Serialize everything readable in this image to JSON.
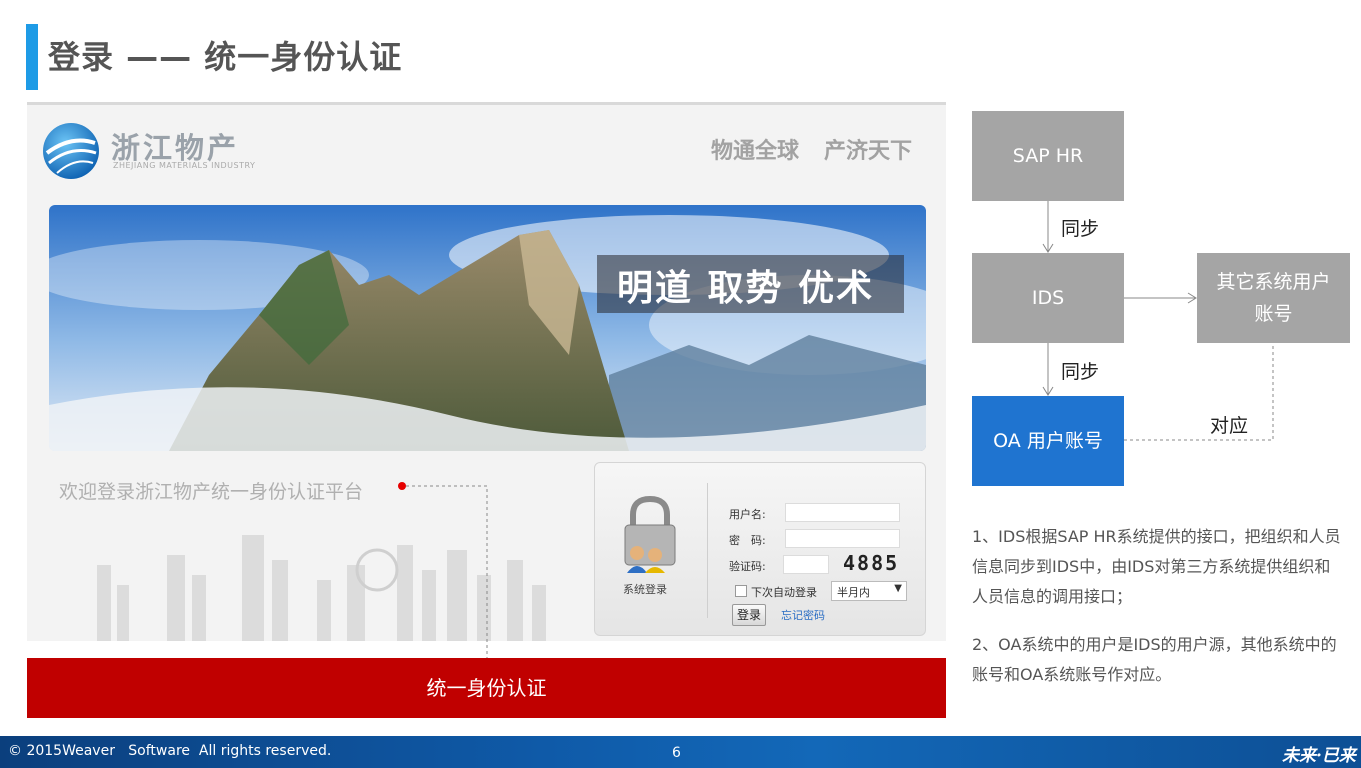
{
  "header": {
    "title": "登录 —— 统一身份认证"
  },
  "screenshot": {
    "brand_name": "浙江物产",
    "brand_sub": "ZHEJIANG MATERIALS INDUSTRY",
    "slogan_1": "物通全球",
    "slogan_2": "产济天下",
    "banner_motto": "明道 取势 优术",
    "welcome_text": "欢迎登录浙江物产统一身份认证平台",
    "login_box": {
      "icon": "padlock-users-icon",
      "system_login_label": "系统登录",
      "username_label": "用户名:",
      "username_value": "",
      "password_label": "密　码:",
      "password_value": "",
      "captcha_label": "验证码:",
      "captcha_value": "",
      "captcha_code": "4885",
      "remember_label": "下次自动登录",
      "duration_selected": "半月内",
      "login_button": "登录",
      "forgot_password": "忘记密码"
    }
  },
  "ids_banner": "统一身份认证",
  "flow": {
    "sap_hr": "SAP HR",
    "ids": "IDS",
    "other_accounts": "其它系统用户账号",
    "oa_accounts": "OA 用户账号",
    "sync_label_1": "同步",
    "sync_label_2": "同步",
    "correspond_label": "对应",
    "box_colors": {
      "gray": "#a5a5a5",
      "blue": "#1f74d0"
    }
  },
  "notes": [
    "1、IDS根据SAP HR系统提供的接口，把组织和人员信息同步到IDS中，由IDS对第三方系统提供组织和人员信息的调用接口；",
    "2、OA系统中的用户是IDS的用户源，其他系统中的账号和OA系统账号作对应。"
  ],
  "footer": {
    "copyright": "© 2015Weaver   Software  All rights reserved.",
    "page_number": "6",
    "logo_text": "未来·已来"
  },
  "colors": {
    "accent": "#1e9be6",
    "banner_red": "#c00000",
    "footer_blue": "#0f5aa8"
  }
}
